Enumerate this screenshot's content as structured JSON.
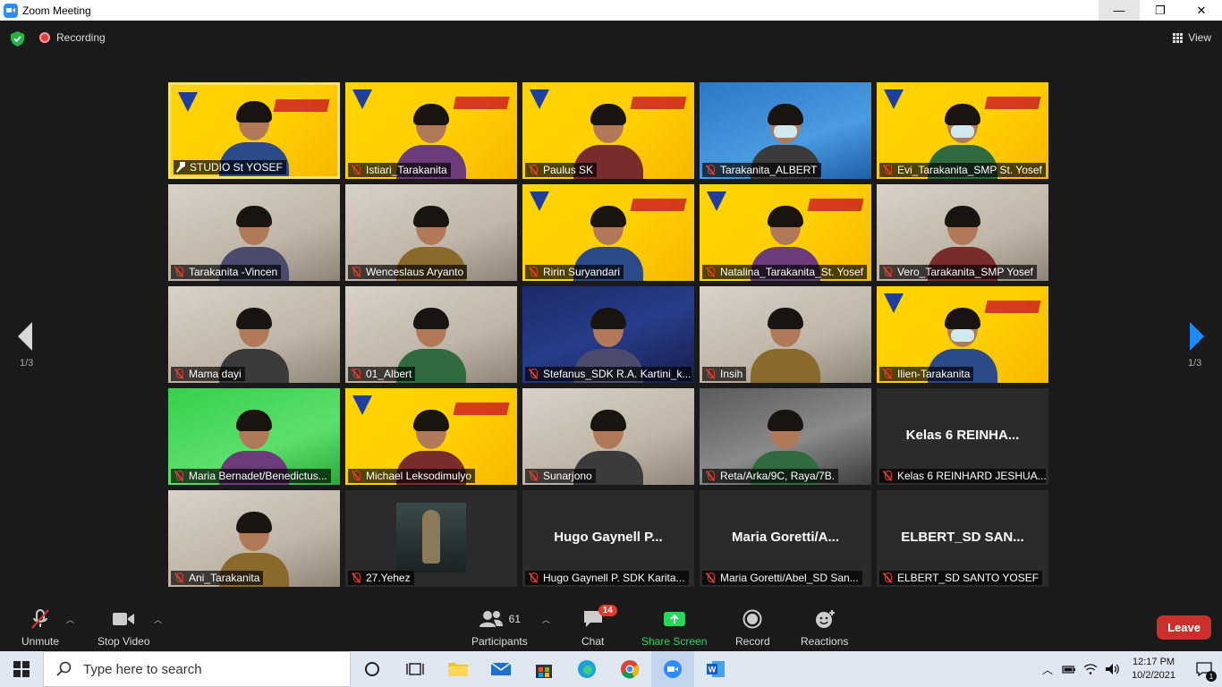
{
  "window": {
    "title": "Zoom Meeting",
    "controls": [
      "—",
      "❐",
      "✕"
    ]
  },
  "topbar": {
    "recording_label": "Recording",
    "view_label": "View"
  },
  "gallery": {
    "page_left": "1/3",
    "page_right": "1/3",
    "tiles": [
      {
        "name": "STUDIO St YOSEF",
        "kind": "banner",
        "active": true
      },
      {
        "name": "Istiari_Tarakanita",
        "kind": "banner"
      },
      {
        "name": "Paulus SK",
        "kind": "banner"
      },
      {
        "name": "Tarakanita_ALBERT",
        "kind": "blue"
      },
      {
        "name": "Evi_Tarakanita_SMP St. Yosef",
        "kind": "banner"
      },
      {
        "name": "Tarakanita -Vincen",
        "kind": "room"
      },
      {
        "name": "Wenceslaus Aryanto",
        "kind": "room"
      },
      {
        "name": "Ririn Suryandari",
        "kind": "banner"
      },
      {
        "name": "Natalina_Tarakanita_St. Yosef",
        "kind": "banner"
      },
      {
        "name": "Vero_Tarakanita_SMP Yosef",
        "kind": "room"
      },
      {
        "name": "Mama dayi",
        "kind": "room"
      },
      {
        "name": "01_Albert",
        "kind": "room"
      },
      {
        "name": "Stefanus_SDK R.A. Kartini_k...",
        "kind": "navy"
      },
      {
        "name": "Insih",
        "kind": "room"
      },
      {
        "name": "Ilien-Tarakanita",
        "kind": "banner"
      },
      {
        "name": "Maria Bernadet/Benedictus...",
        "kind": "green"
      },
      {
        "name": "Michael Leksodimulyo",
        "kind": "banner"
      },
      {
        "name": "Sunarjono",
        "kind": "room"
      },
      {
        "name": "Reta/Arka/9C, Raya/7B.",
        "kind": "gray"
      },
      {
        "name": "Kelas 6 REINHARD JESHUA...",
        "kind": "text",
        "big": "Kelas 6 REINHA..."
      },
      {
        "name": "Ani_Tarakanita",
        "kind": "room"
      },
      {
        "name": "27.Yehez",
        "kind": "avatar"
      },
      {
        "name": "Hugo Gaynell P. SDK Karita...",
        "kind": "text",
        "big": "Hugo Gaynell P..."
      },
      {
        "name": "Maria Goretti/Abel_SD San...",
        "kind": "text",
        "big": "Maria Goretti/A..."
      },
      {
        "name": "ELBERT_SD SANTO YOSEF",
        "kind": "text",
        "big": "ELBERT_SD SAN..."
      }
    ]
  },
  "toolbar": {
    "unmute": "Unmute",
    "stop_video": "Stop Video",
    "participants": "Participants",
    "participants_count": "61",
    "chat": "Chat",
    "chat_badge": "14",
    "share_screen": "Share Screen",
    "record": "Record",
    "reactions": "Reactions",
    "leave": "Leave",
    "share_color": "#23d959",
    "leave_color": "#c9302c"
  },
  "taskbar": {
    "search_placeholder": "Type here to search",
    "time": "12:17 PM",
    "date": "10/2/2021",
    "notification_count": "1"
  }
}
